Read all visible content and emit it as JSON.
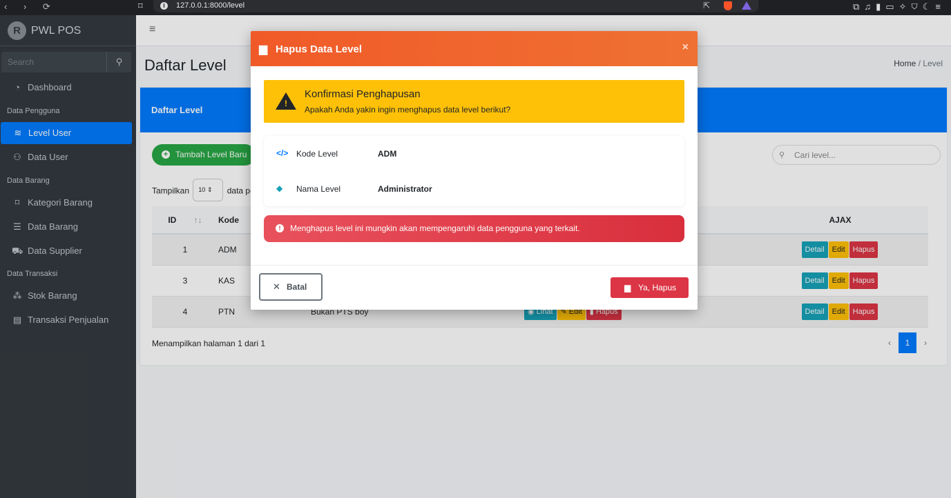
{
  "browser": {
    "url": "127.0.0.1:8000/level"
  },
  "sidebar": {
    "brand": "PWL POS",
    "search_placeholder": "Search",
    "items": [
      {
        "label": "Dashboard",
        "icon": "dashboard-icon"
      },
      {
        "header": "Data Pengguna"
      },
      {
        "label": "Level User",
        "icon": "layers-icon",
        "active": true
      },
      {
        "label": "Data User",
        "icon": "user-icon"
      },
      {
        "header": "Data Barang"
      },
      {
        "label": "Kategori Barang",
        "icon": "bookmark-icon"
      },
      {
        "label": "Data Barang",
        "icon": "list-icon"
      },
      {
        "label": "Data Supplier",
        "icon": "truck-icon"
      },
      {
        "header": "Data Transaksi"
      },
      {
        "label": "Stok Barang",
        "icon": "cubes-icon"
      },
      {
        "label": "Transaksi Penjualan",
        "icon": "cash-register-icon"
      }
    ],
    "header_pengguna": "Data Pengguna",
    "header_barang": "Data Barang",
    "header_transaksi": "Data Transaksi",
    "dashboard": "Dashboard",
    "level_user": "Level User",
    "data_user": "Data User",
    "kategori_barang": "Kategori Barang",
    "data_barang": "Data Barang",
    "data_supplier": "Data Supplier",
    "stok_barang": "Stok Barang",
    "transaksi_penjualan": "Transaksi Penjualan"
  },
  "page": {
    "title": "Daftar Level",
    "breadcrumb_home": "Home",
    "breadcrumb_sep": "/",
    "breadcrumb_current": "Level",
    "card_title": "Daftar Level",
    "add_button": "Tambah Level Baru",
    "show_prefix": "Tampilkan",
    "show_value": "10",
    "show_suffix": "data pe",
    "search_placeholder": "Cari level...",
    "table": {
      "col_id": "ID",
      "col_kode": "Kode",
      "col_ajax": "AJAX",
      "rows": [
        {
          "id": "1",
          "kode": "ADM"
        },
        {
          "id": "3",
          "kode": "KAS"
        },
        {
          "id": "4",
          "kode": "PTN",
          "nama": "Bukan PTS boy"
        }
      ],
      "btn_lihat": "Lihat",
      "btn_edit": "Edit",
      "btn_hapus": "Hapus",
      "btn_detail": "Detail"
    },
    "footer_info": "Menampilkan halaman 1 dari 1",
    "page_number": "1"
  },
  "modal": {
    "title": "Hapus Data Level",
    "close": "×",
    "warn_title": "Konfirmasi Penghapusan",
    "warn_text": "Apakah Anda yakin ingin menghapus data level berikut?",
    "label_kode": "Kode Level",
    "value_kode": "ADM",
    "label_nama": "Nama Level",
    "value_nama": "Administrator",
    "danger_text": "Menghapus level ini mungkin akan mempengaruhi data pengguna yang terkait.",
    "btn_cancel": "Batal",
    "btn_confirm": "Ya, Hapus"
  },
  "colors": {
    "modal_header": "#f05a28",
    "warning": "#ffc107",
    "danger": "#dc3545",
    "primary": "#007bff",
    "success": "#28a745",
    "sidebar": "#343a40"
  }
}
